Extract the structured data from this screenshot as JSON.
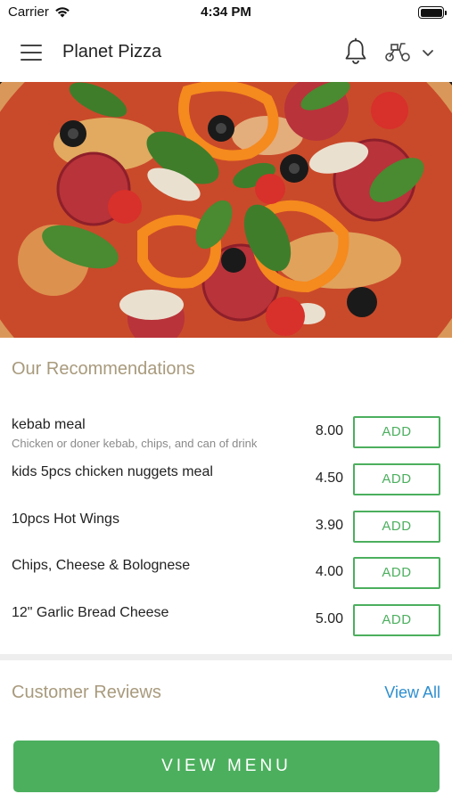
{
  "status_bar": {
    "carrier": "Carrier",
    "time": "4:34 PM"
  },
  "header": {
    "title": "Planet Pizza",
    "icons": [
      "menu-icon",
      "bell-icon",
      "scooter-icon",
      "chevron-down-icon"
    ]
  },
  "hero": {
    "image": "pizza-photo"
  },
  "recommendations": {
    "title": "Our Recommendations",
    "items": [
      {
        "name": "kebab meal",
        "description": "Chicken or doner kebab, chips, and can of drink",
        "price": "8.00",
        "action": "ADD"
      },
      {
        "name": "kids 5pcs chicken nuggets meal",
        "description": "",
        "price": "4.50",
        "action": "ADD"
      },
      {
        "name": "10pcs Hot Wings",
        "description": "",
        "price": "3.90",
        "action": "ADD"
      },
      {
        "name": "Chips, Cheese & Bolognese",
        "description": "",
        "price": "4.00",
        "action": "ADD"
      },
      {
        "name": "12\" Garlic Bread Cheese",
        "description": "",
        "price": "5.00",
        "action": "ADD"
      }
    ]
  },
  "reviews": {
    "title": "Customer Reviews",
    "view_all": "View All"
  },
  "cta": {
    "label": "VIEW MENU"
  },
  "colors": {
    "accent_green": "#4caf5e",
    "section_title": "#a89a7d",
    "link_blue": "#2e8fd0"
  }
}
